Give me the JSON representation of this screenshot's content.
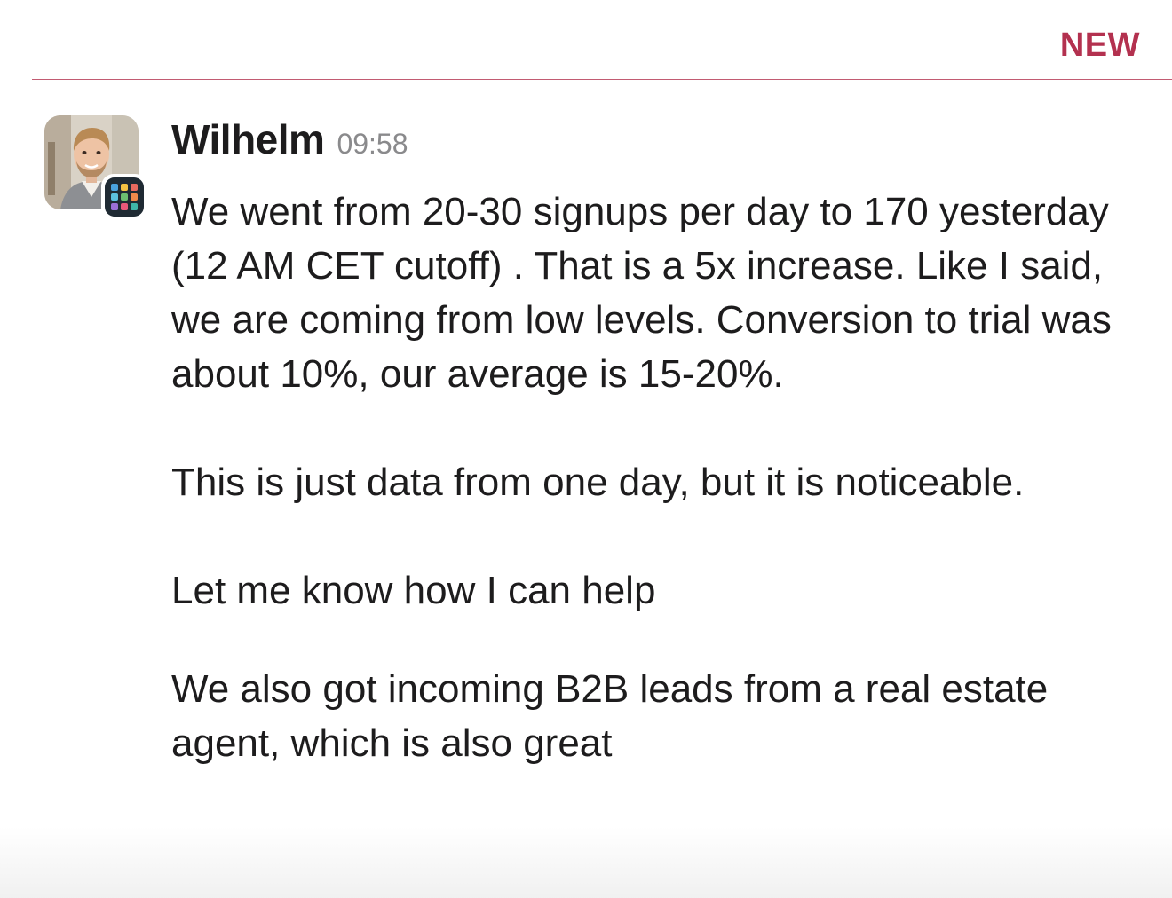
{
  "divider": {
    "label": "NEW",
    "color": "#b3314f"
  },
  "message": {
    "sender": "Wilhelm",
    "time": "09:58",
    "avatar_icon": "user-photo-avatar",
    "app_badge_icon": "app-grid-badge-icon",
    "paragraphs": [
      "We went from 20-30 signups per day to 170 yesterday (12 AM CET cutoff) . That is a 5x increase. Like I said, we are coming from low levels. Conversion to trial was about 10%, our average is 15-20%.",
      "This is just data from one day, but it is noticeable.",
      "Let me know how I can help"
    ],
    "followup": "We also got incoming B2B leads from a real estate agent, which is also great"
  }
}
